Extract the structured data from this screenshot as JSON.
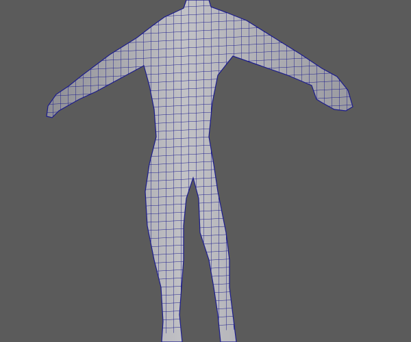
{
  "viewport": {
    "background_color": "#5b5b5b",
    "mesh_fill_color": "#b4b4b8",
    "wireframe_color": "#1c1c8c",
    "display_mode": "wireframe-on-shaded"
  }
}
